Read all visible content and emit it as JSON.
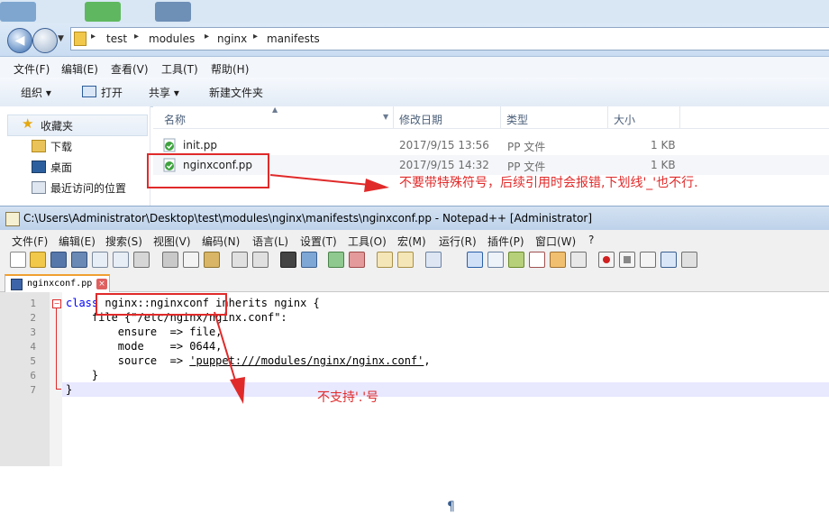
{
  "explorer": {
    "breadcrumb": [
      "test",
      "modules",
      "nginx",
      "manifests"
    ],
    "menu": [
      "文件(F)",
      "编辑(E)",
      "查看(V)",
      "工具(T)",
      "帮助(H)"
    ],
    "toolbar": {
      "organize": "组织 ▾",
      "open": "打开",
      "share": "共享 ▾",
      "new_folder": "新建文件夹"
    },
    "nav": {
      "favorites": "收藏夹",
      "downloads": "下载",
      "desktop": "桌面",
      "recent": "最近访问的位置"
    },
    "columns": {
      "name": "名称",
      "date": "修改日期",
      "type": "类型",
      "size": "大小"
    },
    "files": [
      {
        "name": "init.pp",
        "date": "2017/9/15 13:56",
        "type": "PP 文件",
        "size": "1 KB"
      },
      {
        "name": "nginxconf.pp",
        "date": "2017/9/15 14:32",
        "type": "PP 文件",
        "size": "1 KB"
      }
    ],
    "annotation": "不要带特殊符号，后续引用时会报错,下划线'_'也不行."
  },
  "npp": {
    "title": "C:\\Users\\Administrator\\Desktop\\test\\modules\\nginx\\manifests\\nginxconf.pp - Notepad++ [Administrator]",
    "menu": [
      "文件(F)",
      "编辑(E)",
      "搜索(S)",
      "视图(V)",
      "编码(N)",
      "语言(L)",
      "设置(T)",
      "工具(O)",
      "宏(M)",
      "运行(R)",
      "插件(P)",
      "窗口(W)",
      "?"
    ],
    "tab": "nginxconf.pp",
    "line_numbers": [
      "1",
      "2",
      "3",
      "4",
      "5",
      "6",
      "7"
    ],
    "code": {
      "l1_kw": "class",
      "l1_rest": " nginx::nginxconf inherits nginx {",
      "l2": "    file {\"/etc/nginx/nginx.conf\":",
      "l3": "        ensure  => file,",
      "l4": "        mode    => 0644,",
      "l5_a": "        source  => ",
      "l5_b": "'puppet:///modules/nginx/nginx.conf'",
      "l5_c": ",",
      "l6": "    }",
      "l7": "}"
    },
    "annotation": "不支持'.'号"
  },
  "colors": {
    "annotation_red": "#e02a2a",
    "keyword_blue": "#0000ff"
  }
}
